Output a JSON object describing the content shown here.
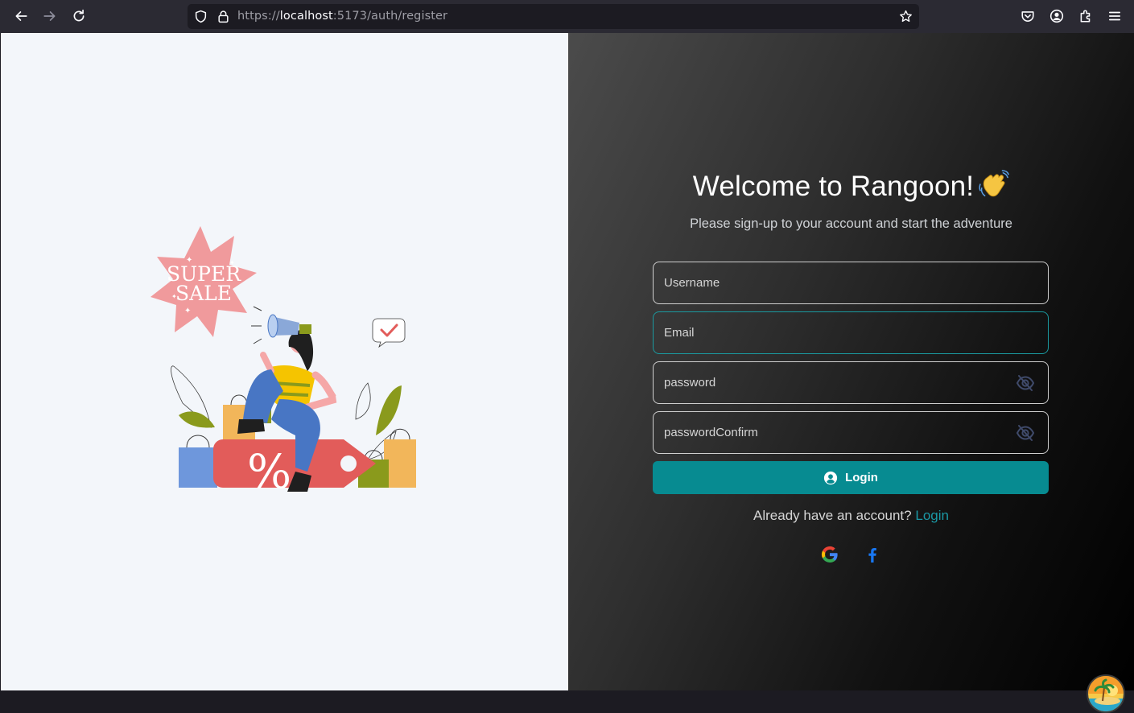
{
  "browser": {
    "url_scheme": "https://",
    "url_host": "localhost",
    "url_rest": ":5173/auth/register",
    "icons": [
      "back-arrow-icon",
      "forward-arrow-icon",
      "reload-icon",
      "shield-icon",
      "lock-icon",
      "star-icon",
      "pocket-icon",
      "account-icon",
      "extensions-icon",
      "menu-icon"
    ]
  },
  "illustration": {
    "badge_line1": "SUPER",
    "badge_line2": "SALE",
    "tag_text": "%"
  },
  "register": {
    "title": "Welcome to Rangoon!",
    "subtitle": "Please sign-up to your account and start the adventure",
    "username_placeholder": "Username",
    "email_placeholder": "Email",
    "password_placeholder": "password",
    "password_confirm_placeholder": "passwordConfirm",
    "submit_label": "Login",
    "already_text": "Already have an account?",
    "login_link": "Login"
  },
  "colors": {
    "accent": "#078b91",
    "link": "#1a98a5",
    "left_bg": "#f3f6fa"
  }
}
